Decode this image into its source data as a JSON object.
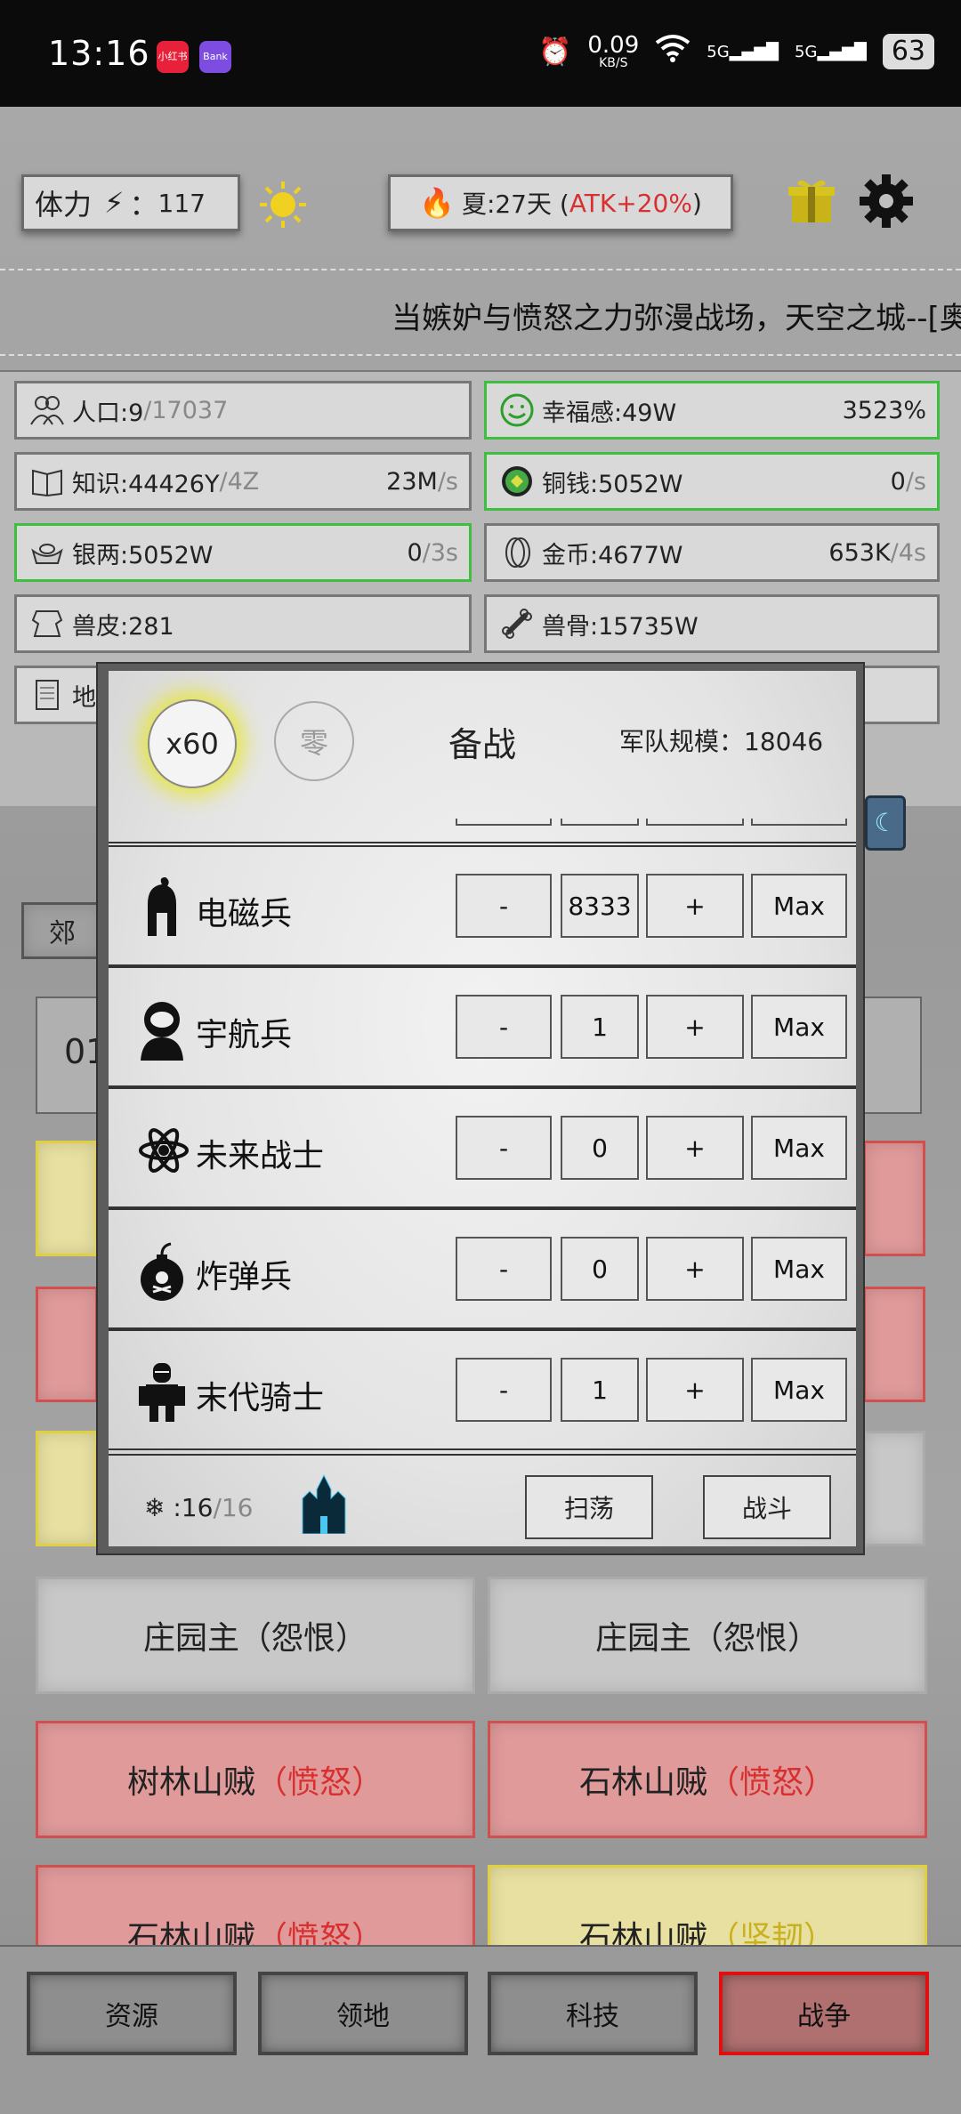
{
  "statusbar": {
    "time": "13:16",
    "app1": "小红书",
    "app2": "Bank",
    "speed": "0.09",
    "speed_unit": "KB/S",
    "net1": "5G",
    "net2": "5G",
    "battery": "63"
  },
  "header": {
    "stamina_label": "体力",
    "stamina_sep": "：",
    "stamina_value": "117",
    "season": "夏:27天 (",
    "season_bonus": "ATK+20%",
    "season_close": ")"
  },
  "marquee": "当嫉妒与愤怒之力弥漫战场，天空之城--[奥",
  "resources": [
    {
      "label": "人口:9",
      "dim": "/17037",
      "rate": "",
      "rate_dim": ""
    },
    {
      "label": "幸福感:49W",
      "dim": "",
      "rate": "3523%",
      "rate_dim": ""
    },
    {
      "label": "知识:44426Y",
      "dim": "/4Z",
      "rate": "23M",
      "rate_dim": "/s"
    },
    {
      "label": "铜钱:5052W",
      "dim": "",
      "rate": "0",
      "rate_dim": "/s"
    },
    {
      "label": "银两:5052W",
      "dim": "",
      "rate": "0",
      "rate_dim": "/3s"
    },
    {
      "label": "金币:4677W",
      "dim": "",
      "rate": "653K",
      "rate_dim": "/4s"
    },
    {
      "label": "兽皮:281",
      "dim": "",
      "rate": "",
      "rate_dim": ""
    },
    {
      "label": "兽骨:15735W",
      "dim": "",
      "rate": "",
      "rate_dim": ""
    },
    {
      "label": "地"
    }
  ],
  "bg": {
    "suburb": "郊",
    "num": "01",
    "targets": [
      {
        "name": "庄园主（怨恨）"
      },
      {
        "name": "庄园主（怨恨）"
      },
      {
        "name": "树林山贼",
        "mood": "（愤怒）"
      },
      {
        "name": "石林山贼",
        "mood": "（愤怒）"
      },
      {
        "name": "石林山贼",
        "mood": "（愤怒）"
      },
      {
        "name": "石林山贼",
        "mood": "（坚韧）"
      }
    ]
  },
  "nav": {
    "res": "资源",
    "land": "领地",
    "tech": "科技",
    "war": "战争"
  },
  "modal": {
    "x60": "x60",
    "zero": "零",
    "title": "备战",
    "army_label": "军队规模：",
    "army_value": "18046",
    "units": [
      {
        "name": "电磁兵",
        "value": "8333",
        "icon": "spartan-helmet-icon"
      },
      {
        "name": "宇航兵",
        "value": "1",
        "icon": "astronaut-icon"
      },
      {
        "name": "未来战士",
        "value": "0",
        "icon": "atom-icon"
      },
      {
        "name": "炸弹兵",
        "value": "0",
        "icon": "bomb-icon"
      },
      {
        "name": "末代骑士",
        "value": "1",
        "icon": "knight-icon"
      }
    ],
    "minus": "-",
    "plus": "+",
    "max": "Max",
    "gen_prefix": ":16",
    "gen_dim": "/16",
    "sweep": "扫荡",
    "fight": "战斗"
  }
}
